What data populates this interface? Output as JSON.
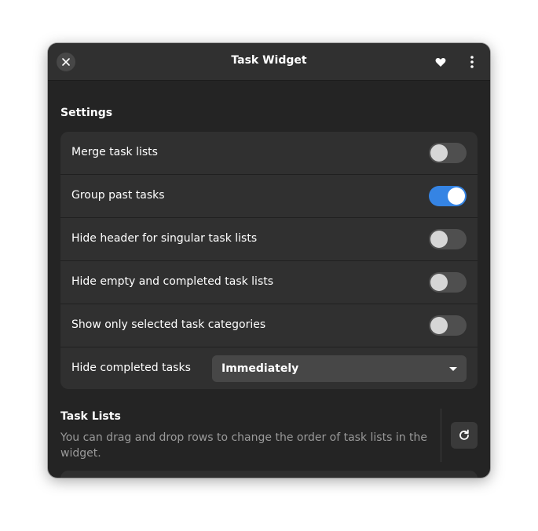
{
  "window": {
    "title": "Task Widget",
    "close_icon": "close-icon",
    "favorite_icon": "heart-icon",
    "menu_icon": "vertical-ellipsis-icon"
  },
  "settings": {
    "heading": "Settings",
    "rows": [
      {
        "label": "Merge task lists",
        "on": false
      },
      {
        "label": "Group past tasks",
        "on": true
      },
      {
        "label": "Hide header for singular task lists",
        "on": false
      },
      {
        "label": "Hide empty and completed task lists",
        "on": false
      },
      {
        "label": "Show only selected task categories",
        "on": false
      }
    ],
    "hide_completed": {
      "label": "Hide completed tasks",
      "value": "Immediately"
    }
  },
  "task_lists": {
    "heading": "Task Lists",
    "description": "You can drag and drop rows to change the order of task lists in the widget.",
    "refresh_icon": "refresh-icon"
  },
  "colors": {
    "accent": "#3584e4",
    "window_bg": "#242424",
    "card_bg": "#303030"
  }
}
